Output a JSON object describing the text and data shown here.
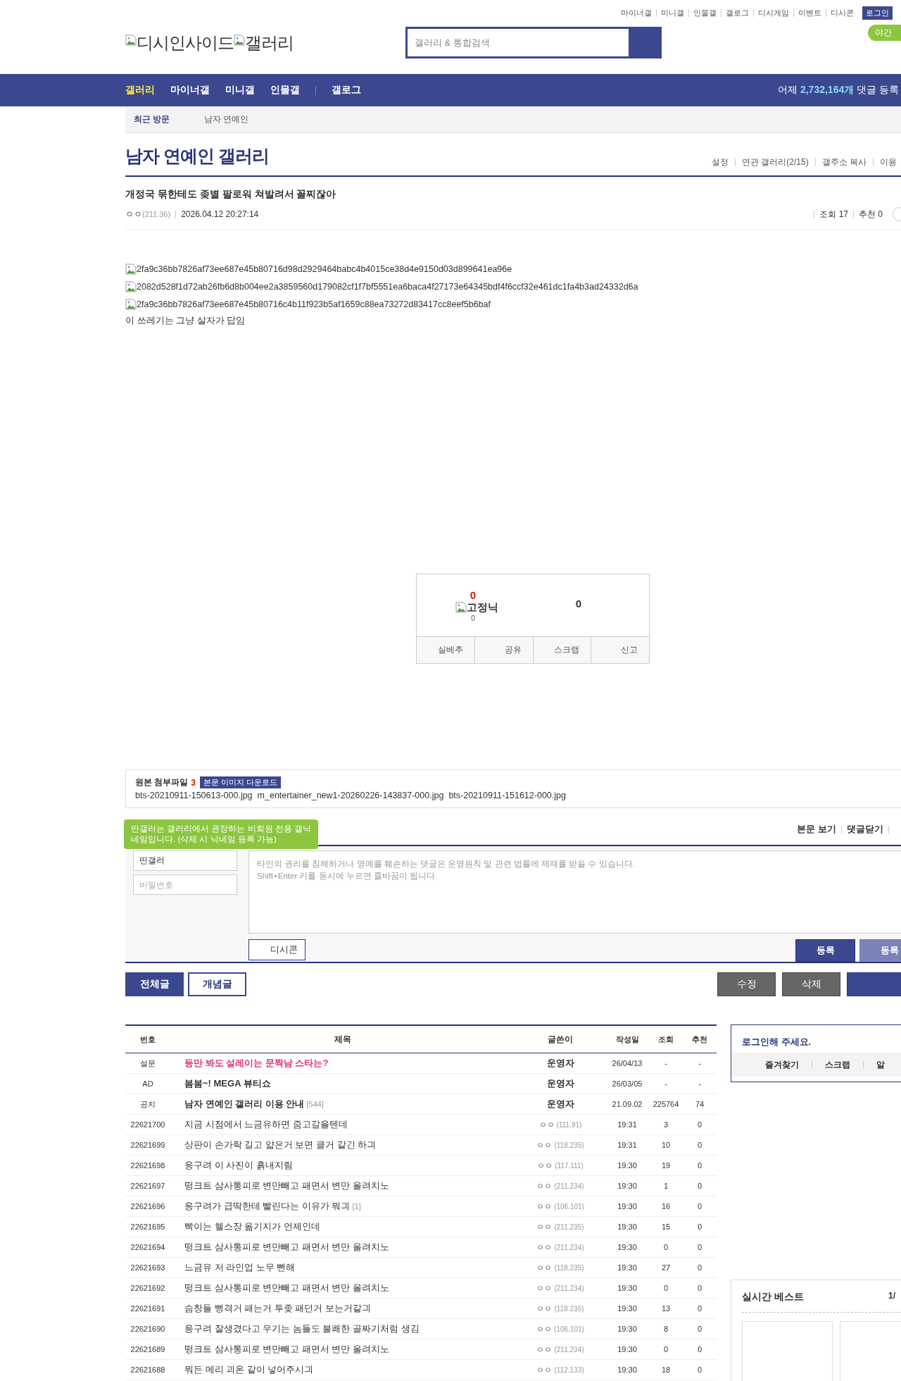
{
  "top_links": [
    "마이너갤",
    "미니갤",
    "인물갤",
    "갤로그",
    "디시게임",
    "이벤트",
    "디시콘"
  ],
  "login_button": "로그인",
  "night_mode_button": "야간",
  "logo": {
    "site": "디시인사이드",
    "section": "갤러리"
  },
  "search": {
    "placeholder": "갤러리 & 통합검색"
  },
  "nav": {
    "items": [
      {
        "label": "갤러리",
        "selected": true
      },
      {
        "label": "마이너갤",
        "selected": false
      },
      {
        "label": "미니갤",
        "selected": false
      },
      {
        "label": "인물갤",
        "selected": false
      },
      {
        "label": "갤로그",
        "selected": false,
        "separated": true
      }
    ],
    "stat": "어제 **2,732,164개** 댓글 등록"
  },
  "recent": {
    "label": "최근 방문",
    "items": [
      "남자 연예인"
    ]
  },
  "gallery": {
    "title": "남자 연예인 갤러리",
    "tools": [
      "설정",
      "연관 갤러리(2/15)",
      "갤주소 복사",
      "이용"
    ]
  },
  "post": {
    "title": "개정국 묶한테도 좆별 팔로워 쳐발려서 꼴찌잖아",
    "writer": "ㅇㅇ",
    "ip": "(211.36)",
    "date": "2026.04.12 20:27:14",
    "views": "조회 17",
    "recommends": "추천 0",
    "images": [
      "2fa9c36bb7826af73ee687e45b80716d98d2929464babc4b4015ce38d4e9150d03d899641ea96e",
      "2082d528f1d72ab26fb6d8b004ee2a3859560d179082cf1f7bf5551ea6baca4f27173e64345bdf4f6ccf32e461dc1fa4b3ad24332d6a",
      "2fa9c36bb7826af73ee687e45b80716c4b11f923b5af1659c88ea73272d83417cc8eef5b6baf"
    ],
    "body": "이 쓰레기는 그냥 살자가 답임"
  },
  "recommend": {
    "up": "0",
    "fixed_label": "고정닉",
    "fixed_count": "0",
    "down": "0",
    "buttons": [
      "실베추",
      "공유",
      "스크랩",
      "신고"
    ]
  },
  "attachments": {
    "label": "원본 첨부파일",
    "count": "3",
    "download": "본문 이미지 다운로드",
    "files": [
      "bts-20210911-150613-000.jpg",
      "m_entertainer_new1-20260226-143837-000.jpg",
      "bts-20210911-151612-000.jpg"
    ]
  },
  "comments": {
    "links": [
      "본문 보기",
      "댓글닫기"
    ],
    "tooltip": "띤갤러는 갤러리에서 권장하는 비회원 전용 갤닉네임입니다. (삭제 시 닉네임 등록 가능)",
    "nickname": "띤갤러",
    "password": {
      "placeholder": "비밀번호"
    },
    "comment": {
      "placeholder": "타인의 권리를 침해하거나 명예를 훼손하는 댓글은 운영원칙 및 관련 법률에 제재를 받을 수 있습니다.\nShift+Enter 키를 동시에 누르면 줄바꿈이 됩니다."
    },
    "dccon_button": "디시콘",
    "submit_buttons": [
      "등록",
      "등록"
    ]
  },
  "list_tabs": [
    {
      "label": "전체글",
      "selected": true
    },
    {
      "label": "개념글",
      "selected": false
    }
  ],
  "post_buttons": [
    "수정",
    "삭제"
  ],
  "list": {
    "columns": [
      "번호",
      "제목",
      "글쓴이",
      "작성일",
      "조회",
      "추천"
    ],
    "rows": [
      {
        "kind": "survey",
        "number": "설문",
        "title": "등만 봐도 설레이는 문짝남 스타는?",
        "writer": "운영자",
        "date": "26/04/13",
        "views": "-",
        "recommends": "-"
      },
      {
        "kind": "ad",
        "number": "AD",
        "title": "봄봄~! MEGA 뷰티쇼",
        "writer": "운영자",
        "date": "26/03/05",
        "views": "-",
        "recommends": "-"
      },
      {
        "kind": "notice",
        "number": "공지",
        "title": "남자 연예인 갤러리 이용 안내",
        "replies": "[544]",
        "writer": "운영자",
        "date": "21.09.02",
        "views": "225764",
        "recommends": "74"
      },
      {
        "kind": "post",
        "number": "22621700",
        "title": "지금 시점에서 느금유하면 줌고갈을텐데",
        "writer": "ㅇㅇ",
        "ip": "(111.91)",
        "date": "19:31",
        "views": "3",
        "recommends": "0"
      },
      {
        "kind": "post",
        "number": "22621699",
        "title": "상판이 손가락 길고 얇은거 보면 클거 같긴 하긔",
        "writer": "ㅇㅇ",
        "ip": "(118.235)",
        "date": "19:31",
        "views": "10",
        "recommends": "0"
      },
      {
        "kind": "post",
        "number": "22621698",
        "title": "응구려 이 사진이 흙내지림",
        "writer": "ㅇㅇ",
        "ip": "(117.111)",
        "date": "19:30",
        "views": "19",
        "recommends": "0"
      },
      {
        "kind": "post",
        "number": "22621697",
        "title": "떵크트 삼사통피로 변만빼고 패면서 변만 올려치노",
        "writer": "ㅇㅇ",
        "ip": "(211.234)",
        "date": "19:30",
        "views": "1",
        "recommends": "0"
      },
      {
        "kind": "post",
        "number": "22621696",
        "title": "응구려가 급딱한테 빨린다는 이유가 뭐긔",
        "replies": "[1]",
        "writer": "ㅇㅇ",
        "ip": "(106.101)",
        "date": "19:30",
        "views": "16",
        "recommends": "0"
      },
      {
        "kind": "post",
        "number": "22621695",
        "title": "빡이는 헬스장 옮기지가 언제인데",
        "writer": "ㅇㅇ",
        "ip": "(211.235)",
        "date": "19:30",
        "views": "15",
        "recommends": "0"
      },
      {
        "kind": "post",
        "number": "22621694",
        "title": "떵크트 삼사통피로 변만빼고 패면서 변만 올려치노",
        "writer": "ㅇㅇ",
        "ip": "(211.234)",
        "date": "19:30",
        "views": "0",
        "recommends": "0"
      },
      {
        "kind": "post",
        "number": "22621693",
        "title": "느금유 저 라인업 노무 뻔해",
        "writer": "ㅇㅇ",
        "ip": "(118.235)",
        "date": "19:30",
        "views": "27",
        "recommends": "0"
      },
      {
        "kind": "post",
        "number": "22621692",
        "title": "떵크트 삼사통피로 변만빼고 패면서 변만 올려치노",
        "writer": "ㅇㅇ",
        "ip": "(211.234)",
        "date": "19:30",
        "views": "0",
        "recommends": "0"
      },
      {
        "kind": "post",
        "number": "22621691",
        "title": "슴창들 뻥격거 패는거 투좆 패던거 보는거같긔",
        "writer": "ㅇㅇ",
        "ip": "(118.235)",
        "date": "19:30",
        "views": "13",
        "recommends": "0"
      },
      {
        "kind": "post",
        "number": "22621690",
        "title": "응구려 잘생겼다고 우기는 놈들도 불쾌한 골짜기처럼 생김",
        "writer": "ㅇㅇ",
        "ip": "(106.101)",
        "date": "19:30",
        "views": "8",
        "recommends": "0"
      },
      {
        "kind": "post",
        "number": "22621689",
        "title": "떵크트 삼사통피로 변만빼고 패면서 변만 올려치노",
        "writer": "ㅇㅇ",
        "ip": "(211.234)",
        "date": "19:30",
        "views": "0",
        "recommends": "0"
      },
      {
        "kind": "post",
        "number": "22621688",
        "title": "뭐든 메리 괴온 같이 넣어주시긔",
        "writer": "ㅇㅇ",
        "ip": "(112.133)",
        "date": "19:30",
        "views": "18",
        "recommends": "0"
      }
    ]
  },
  "sidebar": {
    "login_prompt": "로그인해 주세요.",
    "login_links": [
      "즐겨찾기",
      "스크랩",
      "알"
    ],
    "best_title": "실시간 베스트",
    "best_page": "1/"
  }
}
